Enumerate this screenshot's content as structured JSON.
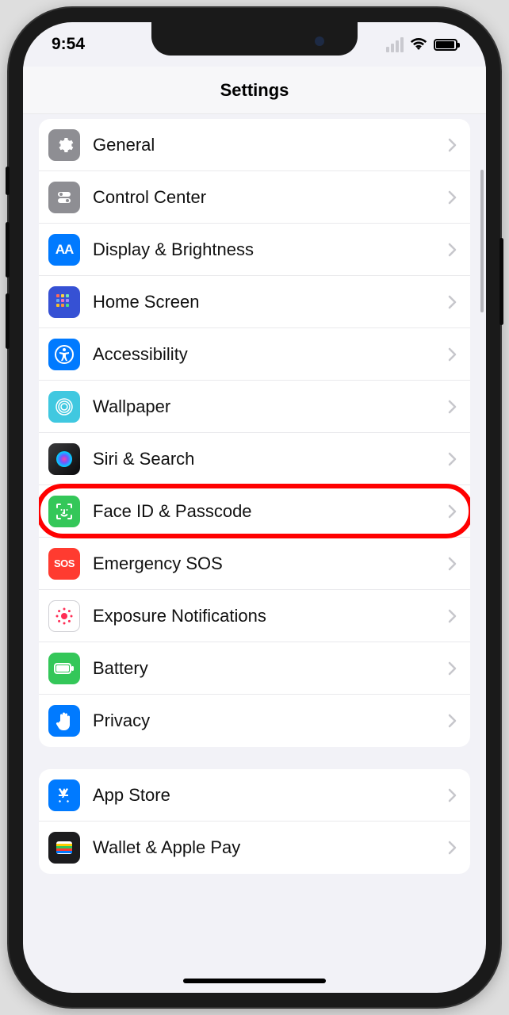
{
  "status": {
    "time": "9:54"
  },
  "header": {
    "title": "Settings"
  },
  "groups": [
    {
      "rows": [
        {
          "id": "general",
          "label": "General"
        },
        {
          "id": "control-center",
          "label": "Control Center"
        },
        {
          "id": "display-brightness",
          "label": "Display & Brightness"
        },
        {
          "id": "home-screen",
          "label": "Home Screen"
        },
        {
          "id": "accessibility",
          "label": "Accessibility"
        },
        {
          "id": "wallpaper",
          "label": "Wallpaper"
        },
        {
          "id": "siri-search",
          "label": "Siri & Search"
        },
        {
          "id": "face-id-passcode",
          "label": "Face ID & Passcode",
          "highlighted": true
        },
        {
          "id": "emergency-sos",
          "label": "Emergency SOS"
        },
        {
          "id": "exposure-notifications",
          "label": "Exposure Notifications"
        },
        {
          "id": "battery",
          "label": "Battery"
        },
        {
          "id": "privacy",
          "label": "Privacy"
        }
      ]
    },
    {
      "rows": [
        {
          "id": "app-store",
          "label": "App Store"
        },
        {
          "id": "wallet-apple-pay",
          "label": "Wallet & Apple Pay"
        }
      ]
    }
  ],
  "sosText": "SOS",
  "aaText": "AA"
}
